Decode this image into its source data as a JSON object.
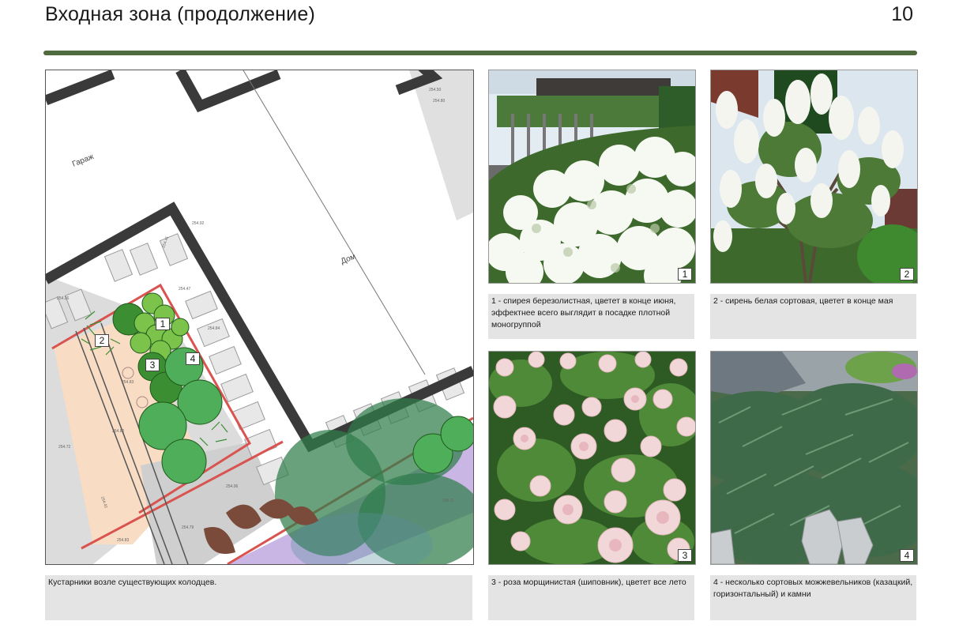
{
  "header": {
    "title": "Входная зона (продолжение)",
    "page_number": "10"
  },
  "plan": {
    "labels": {
      "garage": "Гараж",
      "house": "Дом"
    },
    "markers": [
      "1",
      "2",
      "3",
      "4"
    ],
    "spot_heights": [
      "254.41",
      "254.47",
      "254.92",
      "254.84",
      "254.36",
      "254.80",
      "254.50",
      "254.11",
      "254.06",
      "254.79",
      "254.83",
      "254.72",
      "254.80",
      "254.83",
      "254.42"
    ],
    "caption": "Кустарники возле существующих колодцев."
  },
  "photos": [
    {
      "number": "1",
      "caption": "1 - спирея березолистная, цветет в конце июня, эффектнее всего выглядит в посадке плотной моногруппой"
    },
    {
      "number": "2",
      "caption": "2 - сирень белая сортовая, цветет в конце мая"
    },
    {
      "number": "3",
      "caption": "3 - роза морщинистая (шиповник), цветет все лето"
    },
    {
      "number": "4",
      "caption": "4 - несколько сортовых можжевельников (казацкий, горизонтальный) и камни"
    }
  ],
  "colors": {
    "accent_rule": "#4f6b3f",
    "caption_bg": "#e4e4e4",
    "wall": "#3a3a3a",
    "bed_red": "#d9534f"
  }
}
